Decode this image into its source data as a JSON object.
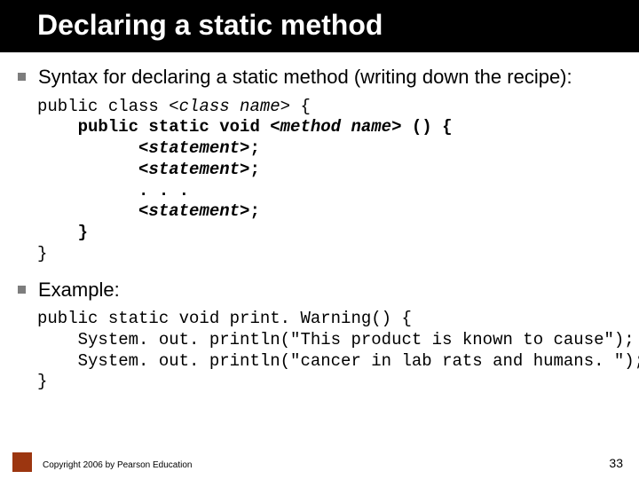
{
  "title": "Declaring a static method",
  "bullets": {
    "intro": "Syntax for declaring a static method (writing down the recipe):",
    "example_label": "Example:"
  },
  "syntax": {
    "l1a": "public class ",
    "l1b": "<class name>",
    "l1c": " {",
    "l2a": "    public static void ",
    "l2b": "<method name>",
    "l2c": " () {",
    "l3a": "          ",
    "l3b": "<statement>",
    "l3c": ";",
    "l4a": "          ",
    "l4b": "<statement>",
    "l4c": ";",
    "l5": "          . . .",
    "l6a": "          ",
    "l6b": "<statement>",
    "l6c": ";",
    "l7": "    }",
    "l8": "}"
  },
  "example": {
    "l1": "public static void print. Warning() {",
    "l2": "    System. out. println(\"This product is known to cause\");",
    "l3": "    System. out. println(\"cancer in lab rats and humans. \");",
    "l4": "}"
  },
  "footer": {
    "copyright": "Copyright 2006 by Pearson Education",
    "page": "33"
  }
}
